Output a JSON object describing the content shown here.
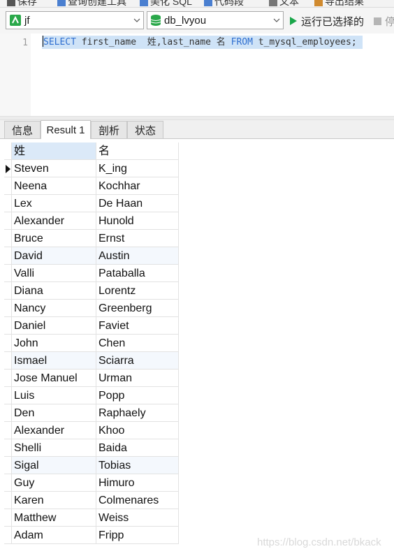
{
  "toolbar": {
    "items": [
      "保存",
      "查询创建工具",
      "美化 SQL",
      "代码段",
      "文本",
      "导出结果"
    ]
  },
  "connection": {
    "label": "jf",
    "icon": "connection-icon"
  },
  "database": {
    "label": "db_lvyou",
    "icon": "database-icon"
  },
  "run": {
    "label": "运行已选择的",
    "icon": "play-icon"
  },
  "stop": {
    "label": "停",
    "icon": "stop-icon"
  },
  "editor": {
    "line_number": "1",
    "kw_select": "SELECT",
    "part1": " first_name  姓,last_name 名 ",
    "kw_from": "FROM",
    "part2": " t_mysql_employees;"
  },
  "tabs": [
    {
      "label": "信息",
      "active": false
    },
    {
      "label": "Result 1",
      "active": true
    },
    {
      "label": "剖析",
      "active": false
    },
    {
      "label": "状态",
      "active": false
    }
  ],
  "result": {
    "columns": [
      "姓",
      "名"
    ],
    "rows": [
      [
        "Steven",
        "K_ing"
      ],
      [
        "Neena",
        "Kochhar"
      ],
      [
        "Lex",
        "De Haan"
      ],
      [
        "Alexander",
        "Hunold"
      ],
      [
        "Bruce",
        "Ernst"
      ],
      [
        "David",
        "Austin"
      ],
      [
        "Valli",
        "Pataballa"
      ],
      [
        "Diana",
        "Lorentz"
      ],
      [
        "Nancy",
        "Greenberg"
      ],
      [
        "Daniel",
        "Faviet"
      ],
      [
        "John",
        "Chen"
      ],
      [
        "Ismael",
        "Sciarra"
      ],
      [
        "Jose Manuel",
        "Urman"
      ],
      [
        "Luis",
        "Popp"
      ],
      [
        "Den",
        "Raphaely"
      ],
      [
        "Alexander",
        "Khoo"
      ],
      [
        "Shelli",
        "Baida"
      ],
      [
        "Sigal",
        "Tobias"
      ],
      [
        "Guy",
        "Himuro"
      ],
      [
        "Karen",
        "Colmenares"
      ],
      [
        "Matthew",
        "Weiss"
      ],
      [
        "Adam",
        "Fripp"
      ]
    ]
  },
  "watermark": "https://blog.csdn.net/bkack",
  "colors": {
    "keyword": "#2f6fd0",
    "selection": "#cfe3f7",
    "run": "#1aa64a",
    "database": "#2aa84a",
    "connection": "#2aa84a"
  }
}
